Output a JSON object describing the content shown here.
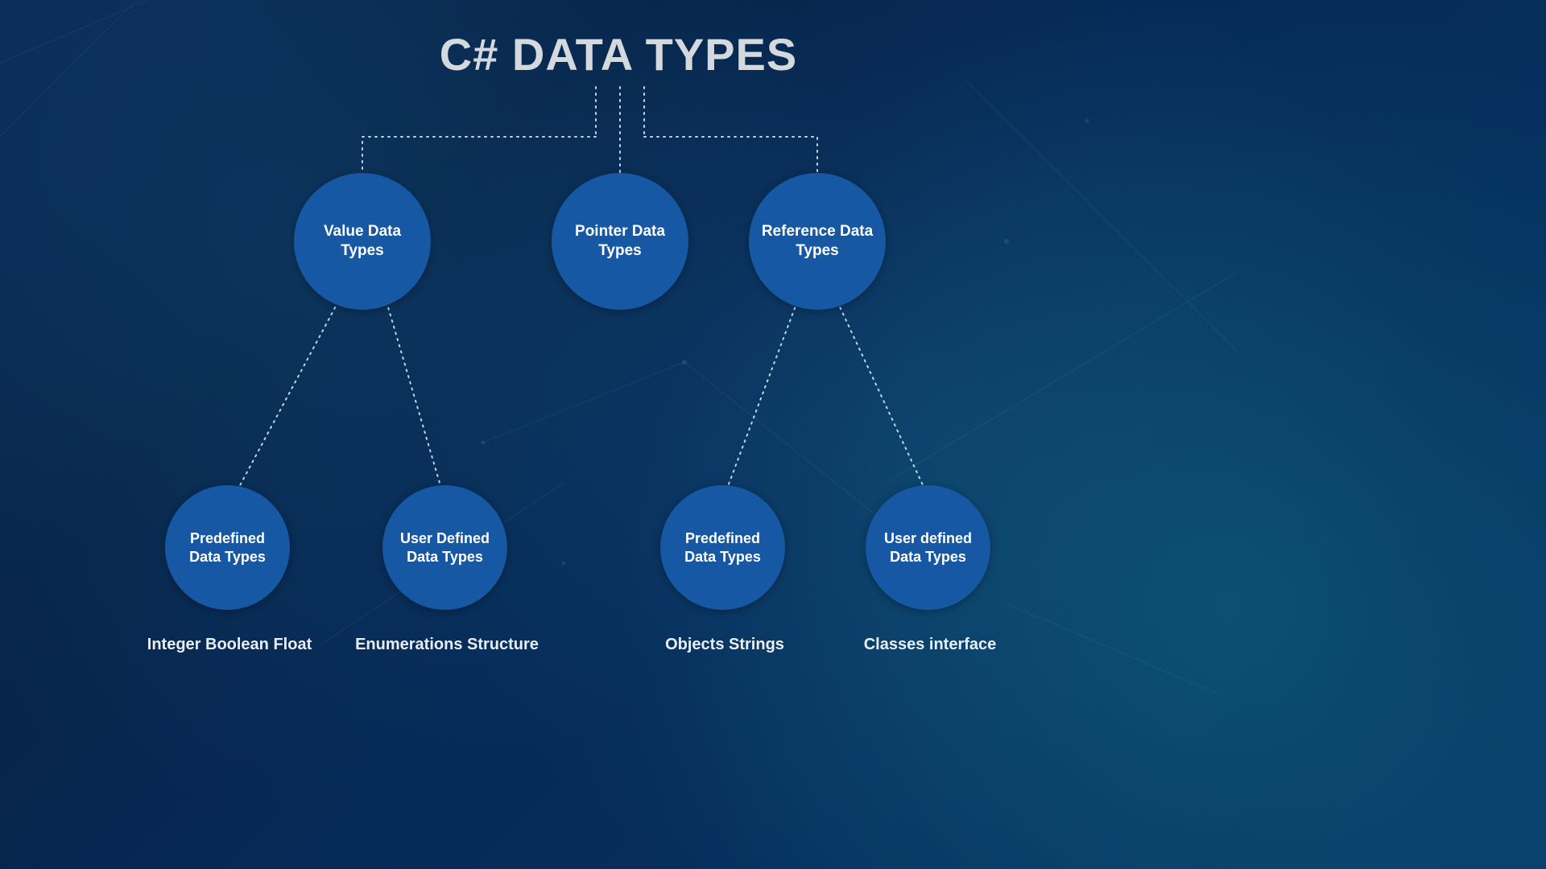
{
  "title": "C# DATA TYPES",
  "level1": {
    "value": "Value Data\nTypes",
    "pointer": "Pointer Data\nTypes",
    "reference": "Reference Data\nTypes"
  },
  "value_children": {
    "predefined": "Predefined\nData Types",
    "userdefined": "User Defined\nData Types"
  },
  "reference_children": {
    "predefined": "Predefined\nData Types",
    "userdefined": "User defined\nData Types"
  },
  "leaf_labels": {
    "value_predef": "Integer Boolean Float",
    "value_user": "Enumerations Structure",
    "ref_predef": "Objects Strings",
    "ref_user": "Classes interface"
  }
}
